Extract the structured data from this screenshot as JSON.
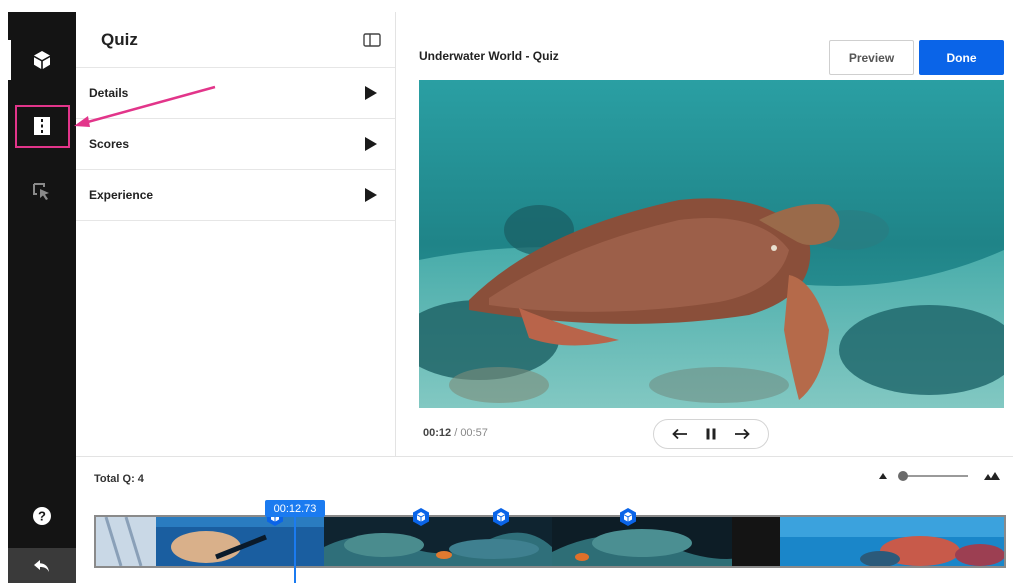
{
  "panel": {
    "title": "Quiz",
    "rows": [
      {
        "label": "Details"
      },
      {
        "label": "Scores"
      },
      {
        "label": "Experience"
      }
    ]
  },
  "main": {
    "title": "Underwater World - Quiz",
    "preview_label": "Preview",
    "done_label": "Done"
  },
  "player": {
    "current_time": "00:12",
    "separator": " / ",
    "duration": "00:57"
  },
  "timeline": {
    "total_label": "Total Q: 4",
    "playhead_time": "00:12.73"
  },
  "colors": {
    "accent": "#0a64e8",
    "highlight": "#e2358a",
    "rail": "#141414"
  },
  "icons": {
    "rail": [
      "cube-icon",
      "chapters-icon",
      "cursor-select-icon",
      "help-icon",
      "back-icon"
    ],
    "panel_toggle": "panel-layout-icon"
  }
}
